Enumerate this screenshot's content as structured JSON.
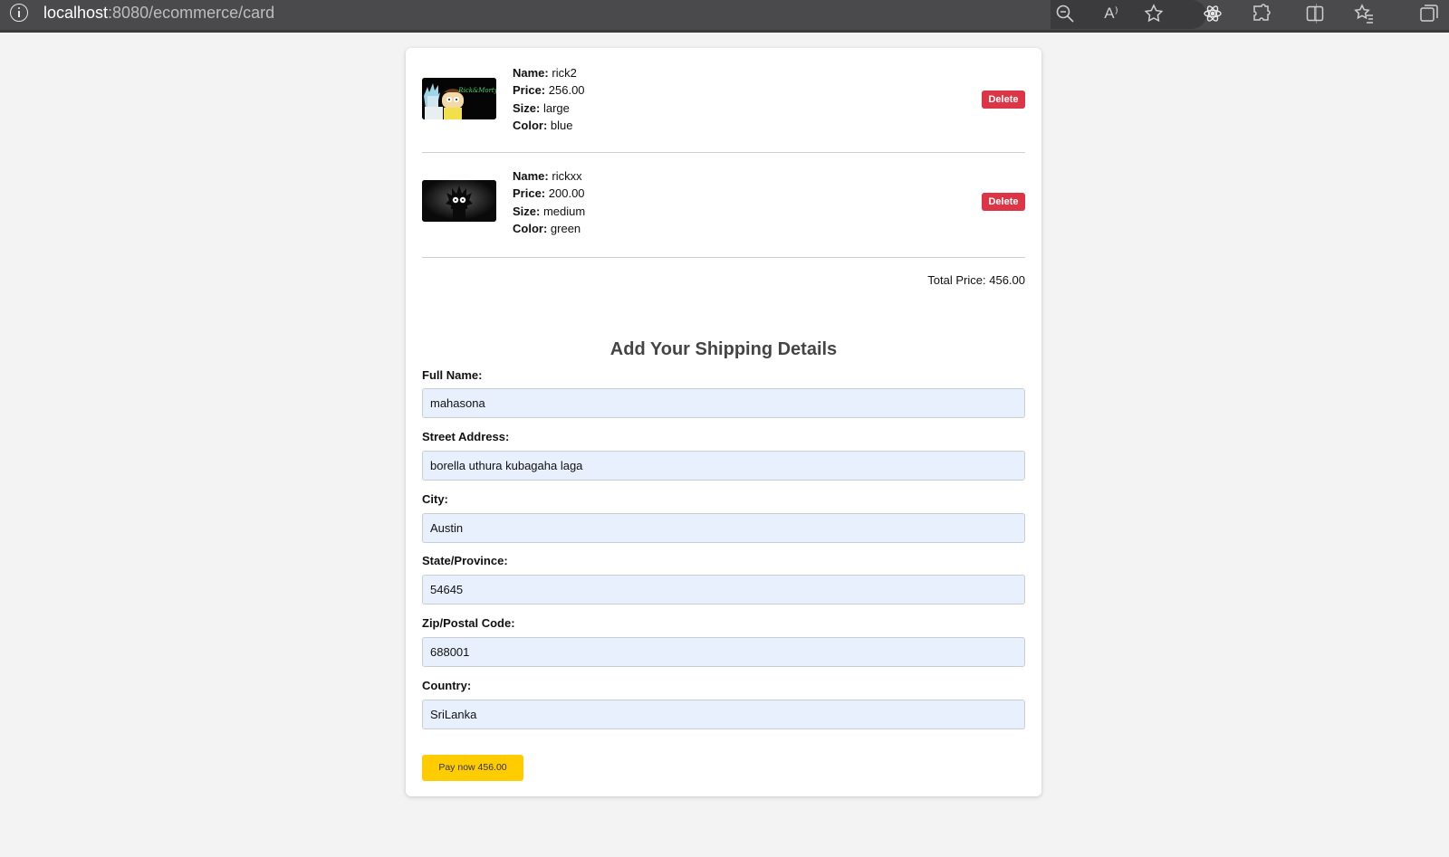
{
  "browser": {
    "url_host": "localhost",
    "url_path": ":8080/ecommerce/card",
    "read_aloud_label": "A⁾"
  },
  "cart": {
    "items": [
      {
        "name_label": "Name:",
        "name": "rick2",
        "price_label": "Price:",
        "price": "256.00",
        "size_label": "Size:",
        "size": "large",
        "color_label": "Color:",
        "color": "blue",
        "delete_label": "Delete",
        "image_logo_text": "Rick and Morty"
      },
      {
        "name_label": "Name:",
        "name": "rickxx",
        "price_label": "Price:",
        "price": "200.00",
        "size_label": "Size:",
        "size": "medium",
        "color_label": "Color:",
        "color": "green",
        "delete_label": "Delete"
      }
    ],
    "total_label": "Total Price:",
    "total_value": "456.00"
  },
  "shipping": {
    "title": "Add Your Shipping Details",
    "fields": [
      {
        "label": "Full Name:",
        "value": "mahasona"
      },
      {
        "label": "Street Address:",
        "value": "borella uthura kubagaha laga"
      },
      {
        "label": "City:",
        "value": "Austin"
      },
      {
        "label": "State/Province:",
        "value": "54645"
      },
      {
        "label": "Zip/Postal Code:",
        "value": "688001"
      },
      {
        "label": "Country:",
        "value": "SriLanka"
      }
    ],
    "pay_label": "Pay now 456.00"
  },
  "colors": {
    "delete_button": "#dc3545",
    "pay_button": "#ffcc00",
    "input_background": "#e8f0fe",
    "browser_bar": "#4a4a4d"
  }
}
